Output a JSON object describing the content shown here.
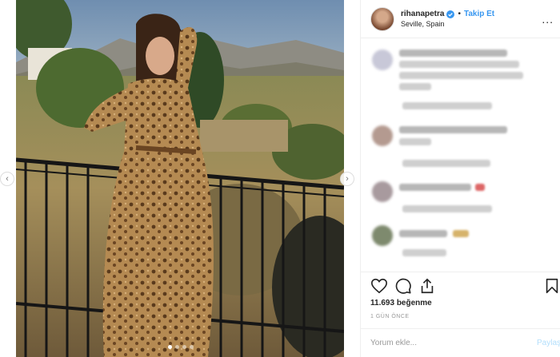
{
  "post": {
    "dots_count": 4,
    "active_dot": 1
  },
  "header": {
    "username": "rihanapetra",
    "follow_label": "Takip Et",
    "separator": "•",
    "location": "Seville, Spain",
    "more_label": "..."
  },
  "actions": {
    "icons": [
      "heart-icon",
      "comment-icon",
      "share-icon",
      "bookmark-icon"
    ],
    "likes": "11.693 beğenme",
    "time": "1 GÜN ÖNCE"
  },
  "comment_bar": {
    "placeholder": "Yorum ekle...",
    "share_label": "Paylaş"
  },
  "colors": {
    "accent": "#3897f0",
    "disabled_accent": "#b2dffc",
    "muted": "#999999"
  }
}
